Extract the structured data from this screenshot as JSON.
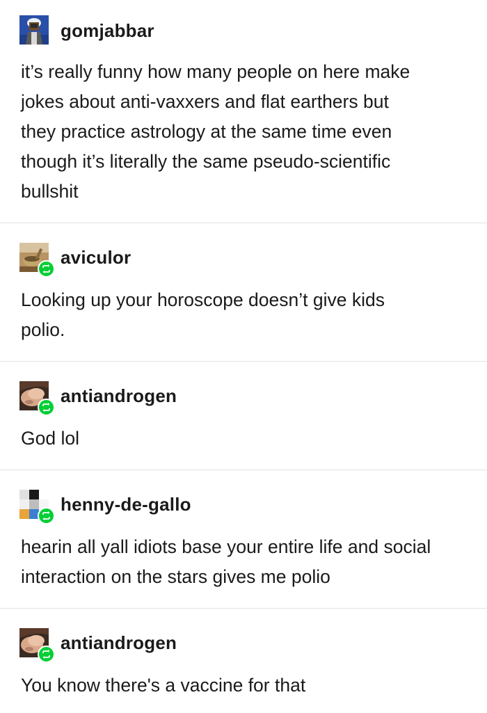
{
  "posts": [
    {
      "username": "gomjabbar",
      "avatar_icon": "astronaut-avatar-icon",
      "reblog": false,
      "lines": [
        "it’s really funny how many people on here make",
        "jokes about anti-vaxxers and flat earthers but",
        "they practice astrology at the same time even",
        "though it’s literally the same pseudo-scientific",
        "bullshit"
      ]
    },
    {
      "username": "aviculor",
      "avatar_icon": "mortar-pestle-avatar-icon",
      "reblog": true,
      "lines": [
        "Looking up your horoscope doesn’t give kids",
        "polio."
      ]
    },
    {
      "username": "antiandrogen",
      "avatar_icon": "face-photo-avatar-icon",
      "reblog": true,
      "lines": [
        "God lol"
      ]
    },
    {
      "username": "henny-de-gallo",
      "avatar_icon": "pixel-blocks-avatar-icon",
      "reblog": true,
      "lines": [
        "hearin all yall idiots base your entire life and social",
        "interaction on the stars gives me polio"
      ]
    },
    {
      "username": "antiandrogen",
      "avatar_icon": "face-photo-avatar-icon",
      "reblog": true,
      "lines": [
        "You know there's a vaccine for that"
      ]
    }
  ],
  "colors": {
    "reblog_badge": "#00cf35",
    "text": "#1a1a1a",
    "divider": "#e3e3e3"
  }
}
